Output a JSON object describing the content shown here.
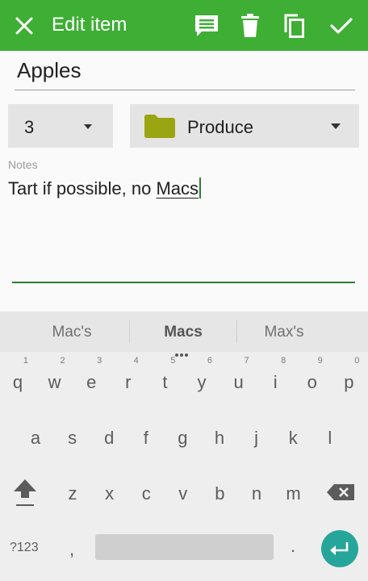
{
  "app_bar": {
    "title": "Edit item",
    "background_color": "#3fae35",
    "icons": [
      "close-icon",
      "comment-icon",
      "delete-icon",
      "copy-icon",
      "check-icon"
    ]
  },
  "item": {
    "name": "Apples",
    "quantity": "3",
    "category": "Produce",
    "category_color": "#9aa512",
    "notes_label": "Notes",
    "notes_prefix": "Tart if possible, no ",
    "notes_current_word": "Macs"
  },
  "keyboard": {
    "suggestions": [
      "Mac's",
      "Macs",
      "Max's"
    ],
    "row1": [
      {
        "ch": "q",
        "hint": "1"
      },
      {
        "ch": "w",
        "hint": "2"
      },
      {
        "ch": "e",
        "hint": "3"
      },
      {
        "ch": "r",
        "hint": "4"
      },
      {
        "ch": "t",
        "hint": "5"
      },
      {
        "ch": "y",
        "hint": "6"
      },
      {
        "ch": "u",
        "hint": "7"
      },
      {
        "ch": "i",
        "hint": "8"
      },
      {
        "ch": "o",
        "hint": "9"
      },
      {
        "ch": "p",
        "hint": "0"
      }
    ],
    "row2": [
      "a",
      "s",
      "d",
      "f",
      "g",
      "h",
      "j",
      "k",
      "l"
    ],
    "row3": [
      "z",
      "x",
      "c",
      "v",
      "b",
      "n",
      "m"
    ],
    "symbols_label": "?123",
    "comma": ",",
    "period": ".",
    "enter_color": "#26a69a"
  }
}
